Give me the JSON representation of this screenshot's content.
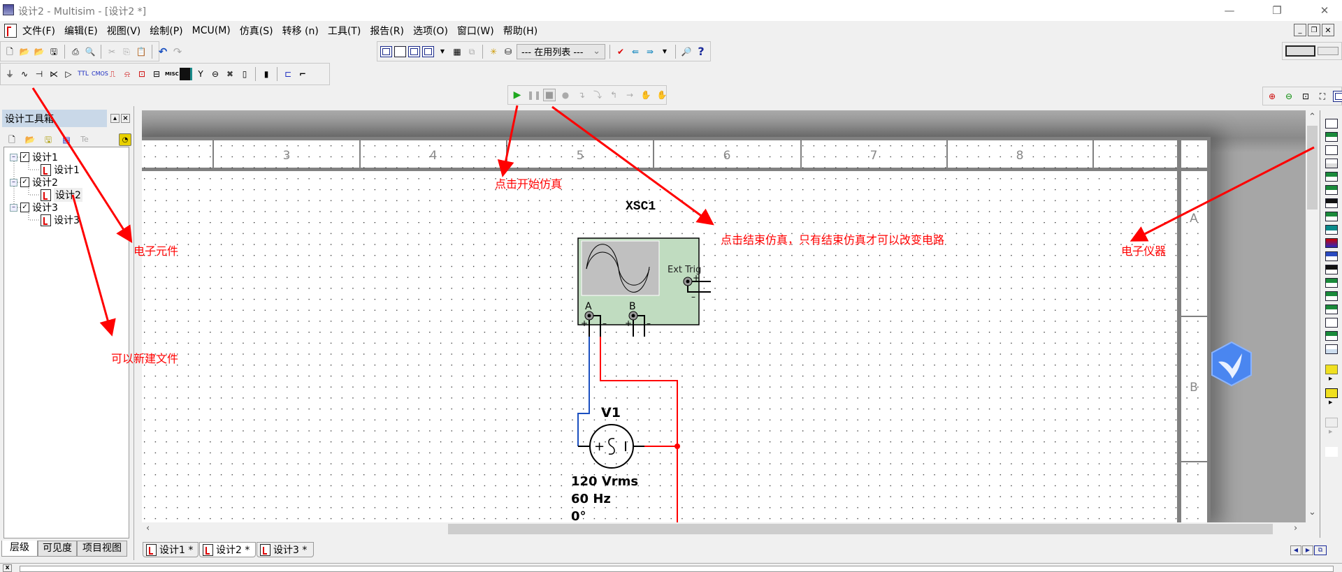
{
  "window": {
    "title": "设计2 - Multisim - [设计2 *]",
    "minimize": "—",
    "restore": "❐",
    "close": "✕"
  },
  "menu": [
    "文件(F)",
    "编辑(E)",
    "视图(V)",
    "绘制(P)",
    "MCU(M)",
    "仿真(S)",
    "转移 (n)",
    "工具(T)",
    "报告(R)",
    "选项(O)",
    "窗口(W)",
    "帮助(H)"
  ],
  "toolbar": {
    "in_use_list": "--- 在用列表 ---",
    "help": "?"
  },
  "component_toolbar": {
    "misc_label": "MISC"
  },
  "design_toolbox": {
    "title": "设计工具箱",
    "disabled_tool_label": "Te",
    "tree": [
      {
        "label": "设计1",
        "child": "设计1"
      },
      {
        "label": "设计2",
        "child": "设计2"
      },
      {
        "label": "设计3",
        "child": "设计3"
      }
    ],
    "tabs": [
      "层级",
      "可见度",
      "项目视图"
    ]
  },
  "sheet": {
    "columns": [
      "3",
      "4",
      "5",
      "6",
      "7",
      "8"
    ],
    "rows": [
      "A",
      "B"
    ]
  },
  "circuit": {
    "scope": {
      "ref": "XSC1",
      "ext_trig": "Ext Trig",
      "channel_a": "A",
      "channel_b": "B"
    },
    "source": {
      "ref": "V1",
      "voltage": "120 Vrms",
      "frequency": "60 Hz",
      "phase": "0°"
    }
  },
  "document_tabs": [
    "设计1 *",
    "设计2 *",
    "设计3 *"
  ],
  "annotations": {
    "components": "电子元件",
    "new_file": "可以新建文件",
    "start_sim": "点击开始仿真",
    "stop_sim": "点击结束仿真，只有结束仿真才可以改变电路",
    "instruments": "电子仪器"
  },
  "colors": {
    "annotation": "#ff0000",
    "wire_a": "#1a4fc0",
    "wire_gnd": "#ff0000",
    "scope_body": "#c0dcc0",
    "sim_run": "#1fa81f"
  }
}
